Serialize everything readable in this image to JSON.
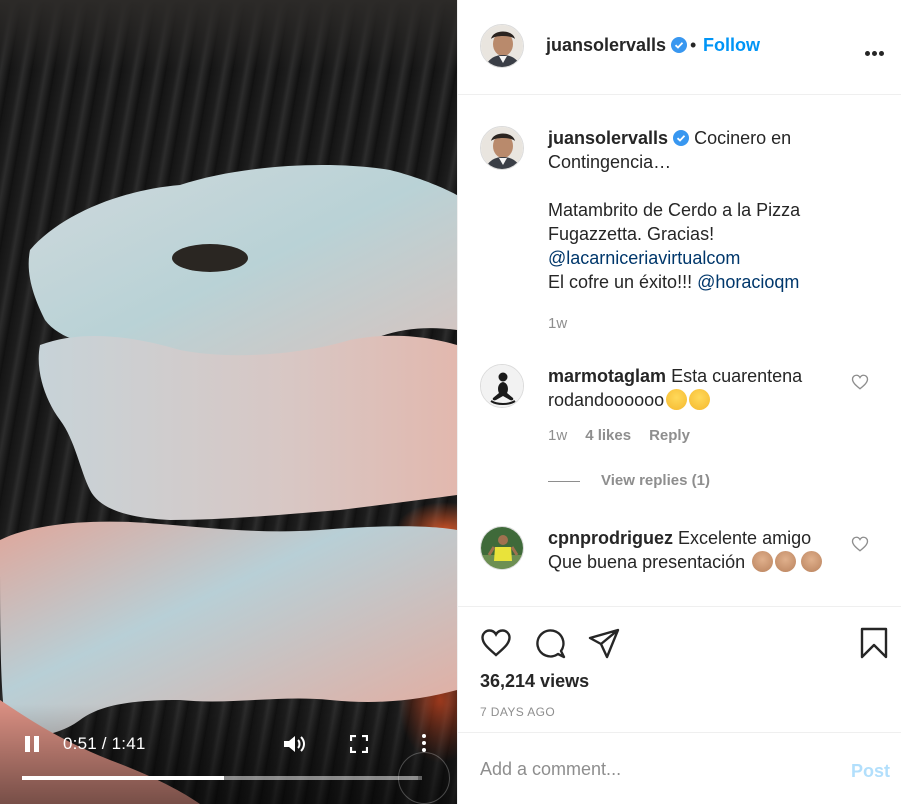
{
  "post": {
    "username": "juansolervalls",
    "follow_label": "Follow",
    "separator": "•",
    "caption_lines": [
      "Cocinero en",
      "Contingencia…",
      "",
      "Matambrito de Cerdo a la Pizza",
      "Fugazzetta. Gracias!"
    ],
    "mention_1": "@lacarniceriavirtualcom",
    "caption_tail": "El cofre un éxito!!! ",
    "mention_2": "@horacioqm",
    "caption_time": "1w"
  },
  "video": {
    "time_display": "0:51 / 1:41",
    "progress_fraction": 0.505,
    "buffered_fraction": 0.99
  },
  "comments": [
    {
      "username": "marmotaglam",
      "text": "Esta cuarentena rodandoooooo",
      "time": "1w",
      "likes": "4 likes",
      "reply_label": "Reply",
      "view_replies": "View replies (1)"
    },
    {
      "username": "cpnprodriguez",
      "text": "Excelente amigo Que buena presentación"
    }
  ],
  "stats": {
    "views": "36,214 views",
    "posted": "7 DAYS AGO"
  },
  "add_comment": {
    "placeholder": "Add a comment...",
    "post_label": "Post"
  },
  "colors": {
    "accent": "#0095f6",
    "mention": "#00376b",
    "muted": "#8e8e8e",
    "post_disabled": "#b2dffc"
  }
}
